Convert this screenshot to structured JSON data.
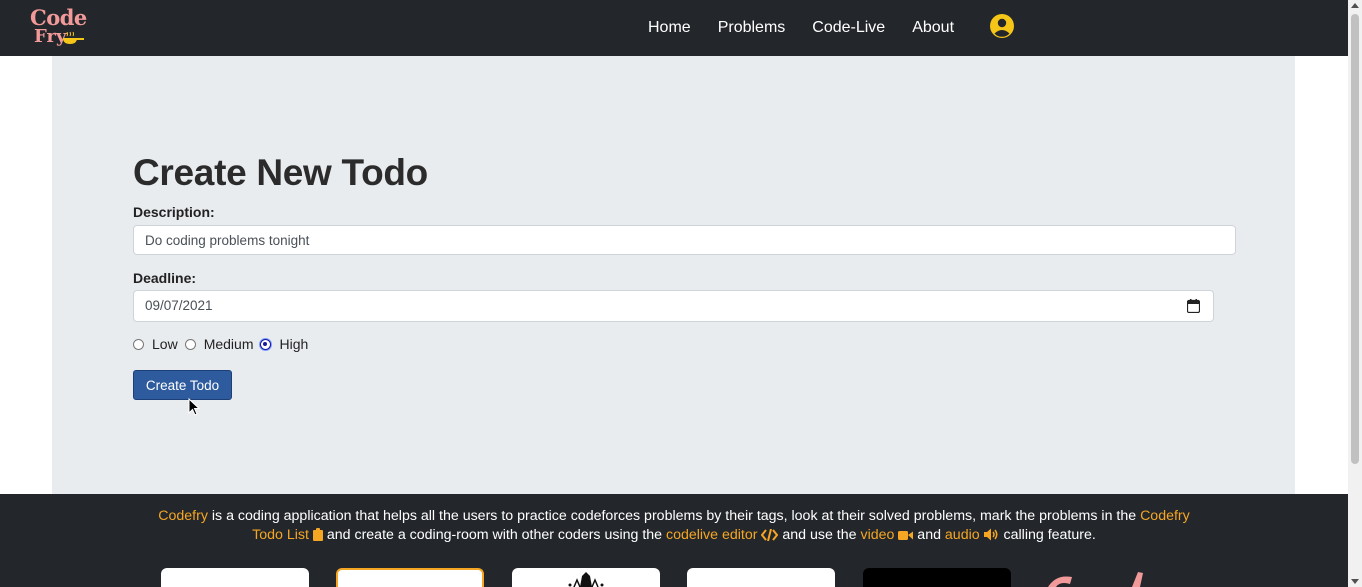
{
  "brand": {
    "line1": "Code",
    "line2": "Fry"
  },
  "nav": {
    "links": [
      "Home",
      "Problems",
      "Code-Live",
      "About"
    ],
    "user_icon": "user-circle-icon"
  },
  "form": {
    "title": "Create New Todo",
    "description_label": "Description:",
    "description_value": "Do coding problems tonight",
    "deadline_label": "Deadline:",
    "deadline_value": "09/07/2021",
    "priority_options": [
      "Low",
      "Medium",
      "High"
    ],
    "priority_selected": "High",
    "submit_label": "Create Todo"
  },
  "footer": {
    "brand": "Codefry",
    "text1": " is a coding application that helps all the users to practice codeforces problems by their tags, look at their solved problems, mark the problems in the ",
    "todo_link": "Codefry Todo List",
    "text2": " and create a coding-room with other coders using the ",
    "editor_link": "codelive editor",
    "text3": " and use the ",
    "video_link": "video",
    "text4": " and ",
    "audio_link": "audio",
    "text5": " calling feature."
  },
  "colors": {
    "accent": "#f5a623",
    "navbar": "#23272b",
    "button": "#2e5a9e",
    "panel": "#e9ecef"
  }
}
